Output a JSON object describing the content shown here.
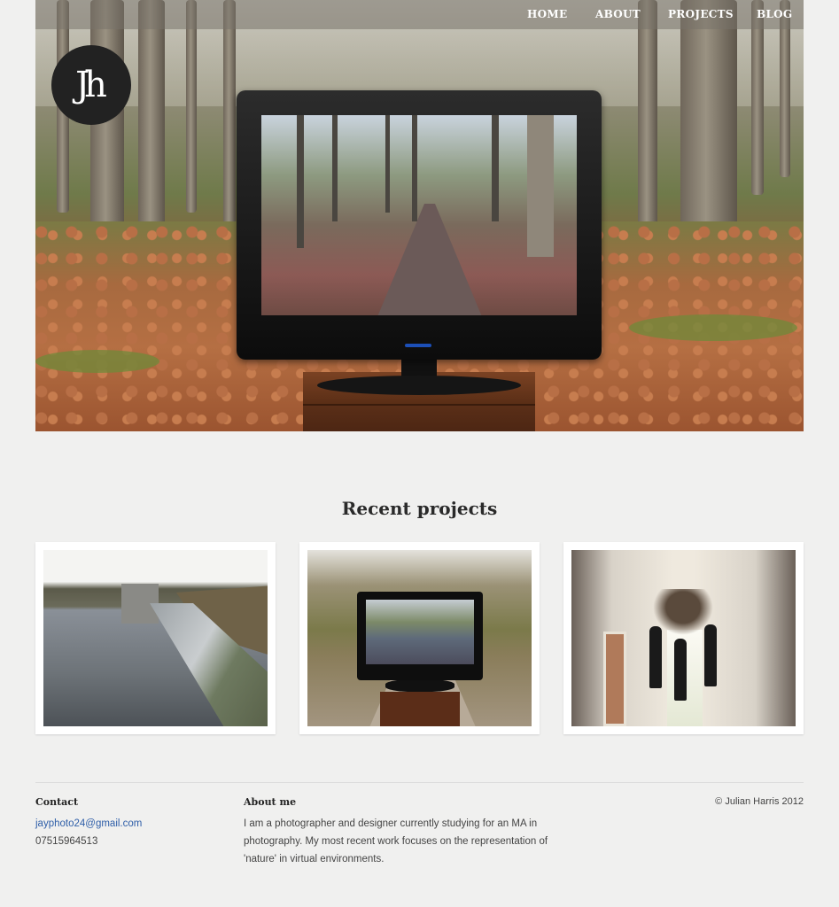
{
  "nav": {
    "items": [
      {
        "label": "HOME"
      },
      {
        "label": "ABOUT"
      },
      {
        "label": "PROJECTS"
      },
      {
        "label": "BLOG"
      }
    ]
  },
  "logo": {
    "text": "Jh"
  },
  "recent": {
    "title": "Recent projects"
  },
  "footer": {
    "contact": {
      "heading": "Contact",
      "email": "jayphoto24@gmail.com",
      "phone": "07515964513"
    },
    "about": {
      "heading": "About me",
      "lines": [
        "I am a photographer and designer currently studying for an MA in",
        "photography. My most recent work focuses on the representation of",
        "'nature' in virtual environments."
      ]
    },
    "copyright": "© Julian Harris 2012"
  },
  "colors": {
    "background": "#f0f0ef",
    "nav_bar": "#78736980",
    "logo_circle": "#222222",
    "link": "#2e5ea8"
  }
}
